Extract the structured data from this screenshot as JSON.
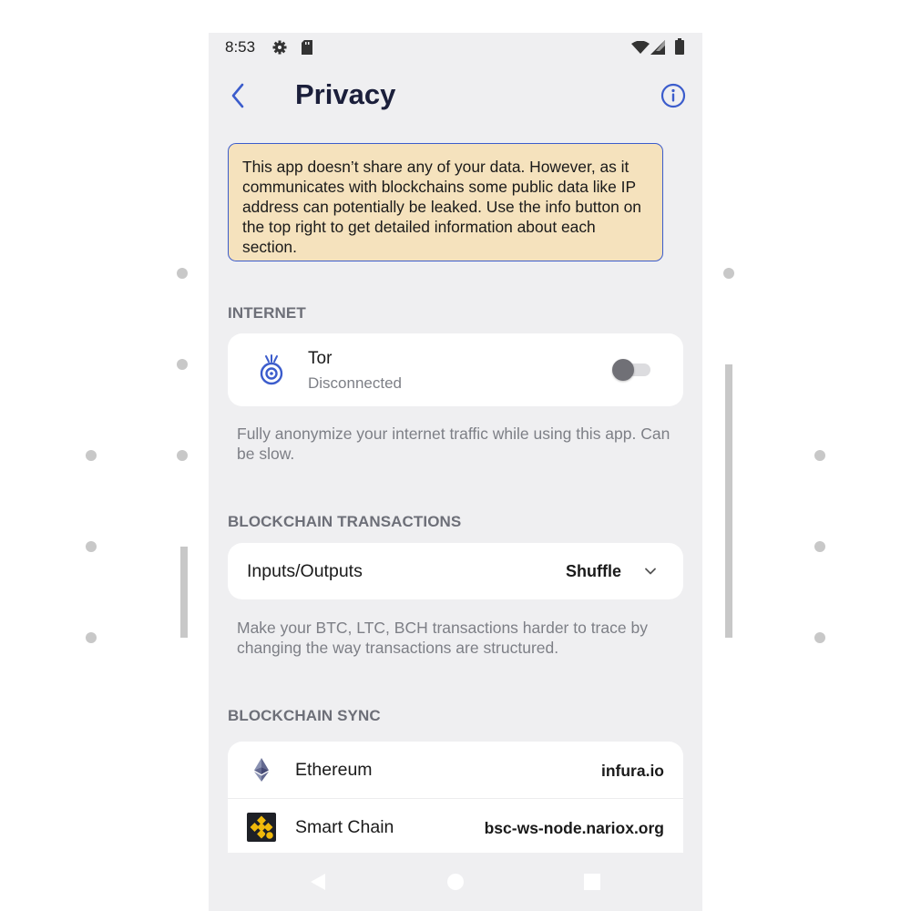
{
  "status_bar": {
    "time": "8:53",
    "icons": [
      "gear-icon",
      "sd-card-icon",
      "wifi-icon",
      "signal-icon",
      "battery-icon"
    ]
  },
  "header": {
    "title": "Privacy",
    "back_icon": "chevron-left-icon",
    "info_icon": "info-circle-icon"
  },
  "notice": {
    "text": "This app doesn’t share any of your data. However, as it communicates with blockchains some public data like IP address can potentially be leaked. Use the info button on the top right to get detailed information about each section."
  },
  "internet": {
    "header": "INTERNET",
    "tor": {
      "title": "Tor",
      "status": "Disconnected",
      "enabled": false,
      "icon": "tor-onion-icon"
    },
    "description": "Fully anonymize your internet traffic while using this app. Can be slow."
  },
  "transactions": {
    "header": "BLOCKCHAIN TRANSACTIONS",
    "inputs_outputs": {
      "label": "Inputs/Outputs",
      "value": "Shuffle"
    },
    "description": "Make your BTC, LTC, BCH transactions harder to trace by changing the way transactions are structured."
  },
  "sync": {
    "header": "BLOCKCHAIN SYNC",
    "items": [
      {
        "name": "Ethereum",
        "value": "infura.io",
        "icon": "ethereum-icon"
      },
      {
        "name": "Smart Chain",
        "value": "bsc-ws-node.nariox.org",
        "icon": "binance-smart-chain-icon"
      }
    ]
  },
  "colors": {
    "accent": "#3b5ccc",
    "notice_bg": "#f5e2bd",
    "page_bg": "#efeff1",
    "card_bg": "#ffffff"
  }
}
